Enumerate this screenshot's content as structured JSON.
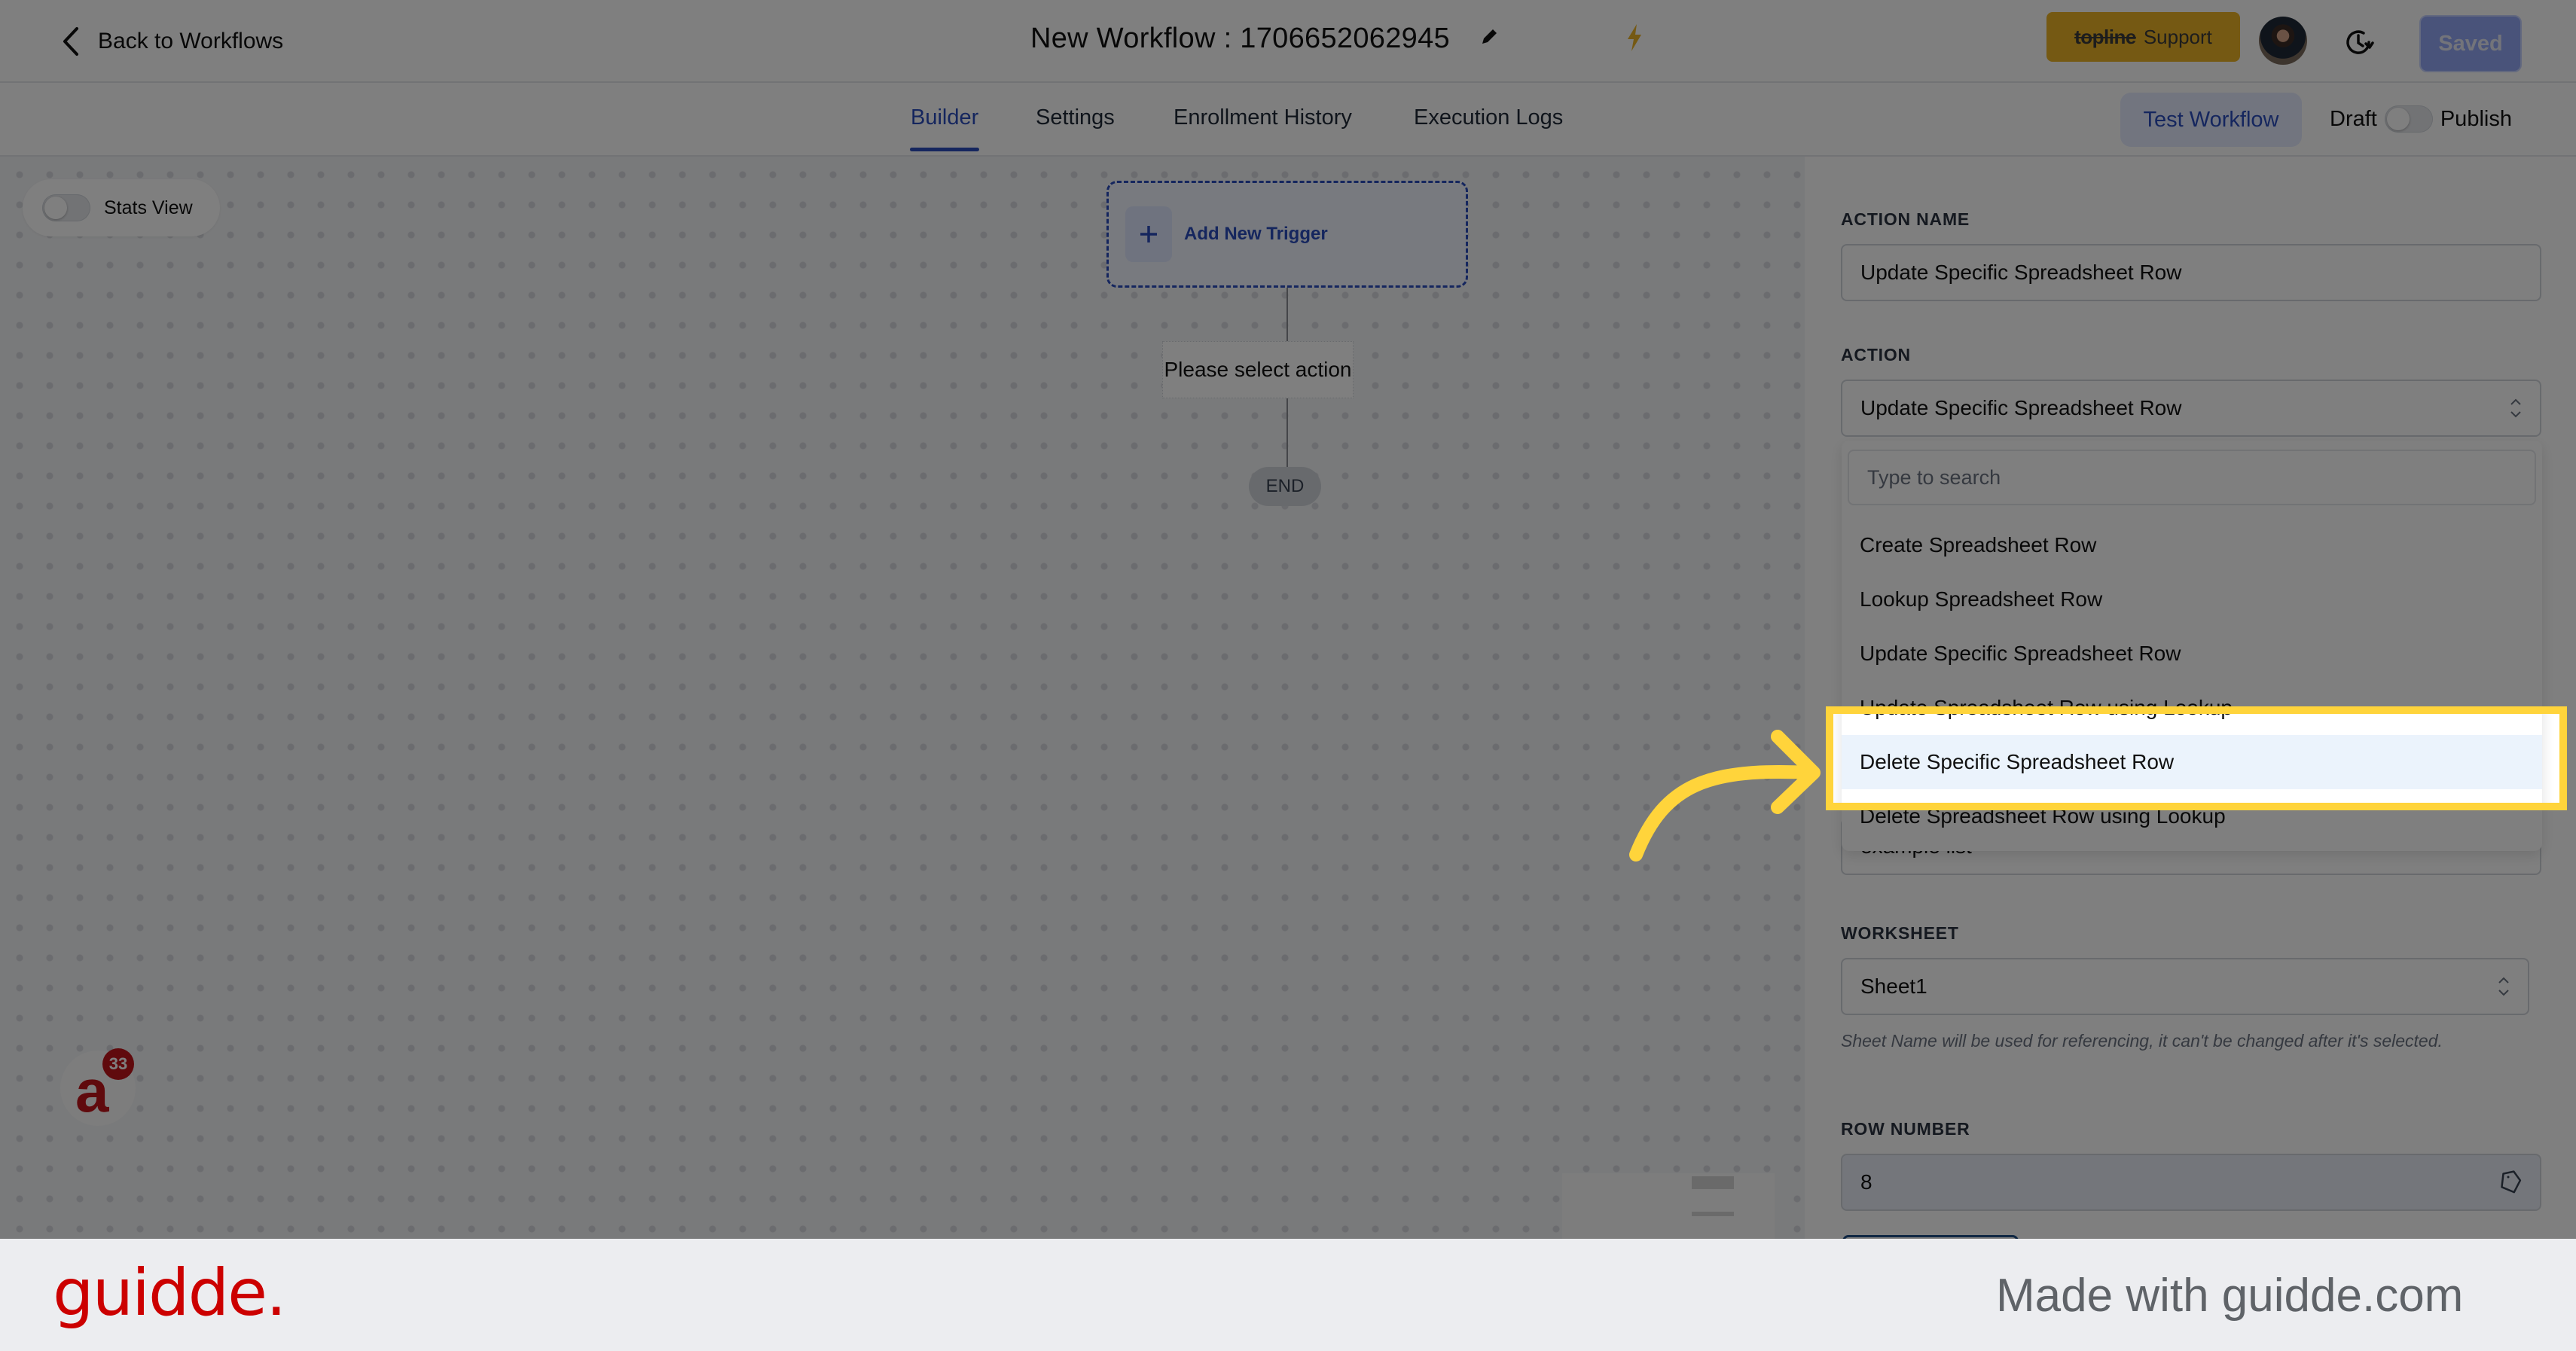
{
  "header": {
    "back_label": "Back to Workflows",
    "workflow_title": "New Workflow : 1706652062945",
    "support_brand": "topline",
    "support_label": "Support",
    "saved_label": "Saved"
  },
  "tabs": [
    {
      "label": "Builder",
      "active": true
    },
    {
      "label": "Settings",
      "active": false
    },
    {
      "label": "Enrollment History",
      "active": false
    },
    {
      "label": "Execution Logs",
      "active": false
    }
  ],
  "toolbar": {
    "test_workflow_label": "Test Workflow",
    "draft_label": "Draft",
    "publish_label": "Publish"
  },
  "canvas": {
    "stats_view_label": "Stats View",
    "add_trigger_label": "Add New Trigger",
    "action_placeholder": "Please select action",
    "end_label": "END",
    "chat_badge_count": "33"
  },
  "panel": {
    "action_name_label": "ACTION NAME",
    "action_name_value": "Update Specific Spreadsheet Row",
    "action_label": "ACTION",
    "action_value": "Update Specific Spreadsheet Row",
    "hidden_field_value": "example list",
    "worksheet_label": "WORKSHEET",
    "worksheet_value": "Sheet1",
    "worksheet_hint": "Sheet Name will be used for referencing, it can't be changed after it's selected.",
    "row_number_label": "ROW NUMBER",
    "row_number_value": "8"
  },
  "dropdown": {
    "search_placeholder": "Type to search",
    "options": [
      {
        "label": "Create Spreadsheet Row"
      },
      {
        "label": "Lookup Spreadsheet Row"
      },
      {
        "label": "Update Specific Spreadsheet Row"
      },
      {
        "label": "Update Spreadsheet Row using Lookup"
      },
      {
        "label": "Delete Specific Spreadsheet Row",
        "highlighted": true
      },
      {
        "label": "Delete Spreadsheet Row using Lookup"
      }
    ]
  },
  "footer": {
    "logo": "guidde.",
    "made_with": "Made with guidde.com"
  },
  "colors": {
    "accent": "#2b4dbd",
    "support": "#eab226",
    "highlight_frame": "#ffd43b",
    "guidde_red": "#cc0000"
  }
}
